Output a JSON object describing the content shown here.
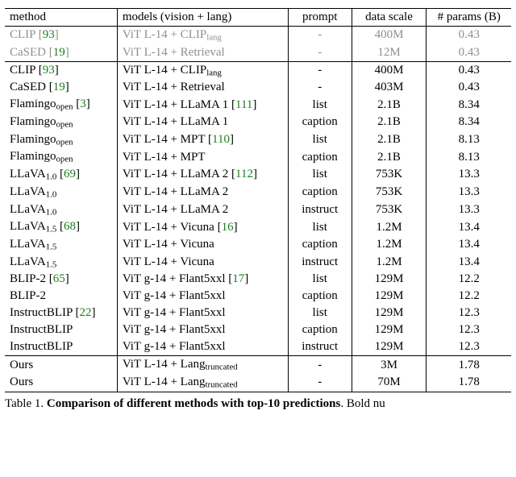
{
  "headers": {
    "method": "method",
    "models": "models (vision + lang)",
    "prompt": "prompt",
    "data_scale": "data scale",
    "params": "# params (B)"
  },
  "rows": [
    {
      "grey": true,
      "method": "CLIP",
      "ref": "93",
      "model_pre": "ViT L-14 + CLIP",
      "model_sub": "lang",
      "model_refs": [],
      "prompt": "-",
      "scale": "400M",
      "params": "0.43",
      "sect_start": true
    },
    {
      "grey": true,
      "method": "CaSED",
      "ref": "19",
      "model_pre": "ViT L-14 + Retrieval",
      "model_sub": "",
      "model_refs": [],
      "prompt": "-",
      "scale": "12M",
      "params": "0.43"
    },
    {
      "method": "CLIP",
      "ref": "93",
      "model_pre": "ViT L-14 + CLIP",
      "model_sub": "lang",
      "model_refs": [],
      "prompt": "-",
      "scale": "400M",
      "params": "0.43",
      "sect_start": true
    },
    {
      "method": "CaSED",
      "ref": "19",
      "model_pre": "ViT L-14 + Retrieval",
      "model_sub": "",
      "model_refs": [],
      "prompt": "-",
      "scale": "403M",
      "params": "0.43"
    },
    {
      "method": "Flamingo",
      "method_sub": "open",
      "ref": "3",
      "model_pre": "ViT L-14 + LLaMA 1",
      "model_sub": "",
      "model_refs": [
        "111"
      ],
      "prompt": "list",
      "scale": "2.1B",
      "params": "8.34"
    },
    {
      "method": "Flamingo",
      "method_sub": "open",
      "ref": "",
      "model_pre": "ViT L-14 + LLaMA 1",
      "model_sub": "",
      "model_refs": [],
      "prompt": "caption",
      "scale": "2.1B",
      "params": "8.34"
    },
    {
      "method": "Flamingo",
      "method_sub": "open",
      "ref": "",
      "model_pre": "ViT L-14 + MPT",
      "model_sub": "",
      "model_refs": [
        "110"
      ],
      "prompt": "list",
      "scale": "2.1B",
      "params": "8.13"
    },
    {
      "method": "Flamingo",
      "method_sub": "open",
      "ref": "",
      "model_pre": "ViT L-14 + MPT",
      "model_sub": "",
      "model_refs": [],
      "prompt": "caption",
      "scale": "2.1B",
      "params": "8.13"
    },
    {
      "method": "LLaVA",
      "method_sub": "1.0",
      "ref": "69",
      "model_pre": "ViT L-14 + LLaMA 2",
      "model_sub": "",
      "model_refs": [
        "112"
      ],
      "prompt": "list",
      "scale": "753K",
      "params": "13.3"
    },
    {
      "method": "LLaVA",
      "method_sub": "1.0",
      "ref": "",
      "model_pre": "ViT L-14 + LLaMA 2",
      "model_sub": "",
      "model_refs": [],
      "prompt": "caption",
      "scale": "753K",
      "params": "13.3"
    },
    {
      "method": "LLaVA",
      "method_sub": "1.0",
      "ref": "",
      "model_pre": "ViT L-14 + LLaMA 2",
      "model_sub": "",
      "model_refs": [],
      "prompt": "instruct",
      "scale": "753K",
      "params": "13.3"
    },
    {
      "method": "LLaVA",
      "method_sub": "1.5",
      "ref": "68",
      "model_pre": "ViT L-14 + Vicuna",
      "model_sub": "",
      "model_refs": [
        "16"
      ],
      "prompt": "list",
      "scale": "1.2M",
      "params": "13.4"
    },
    {
      "method": "LLaVA",
      "method_sub": "1.5",
      "ref": "",
      "model_pre": "ViT L-14 + Vicuna",
      "model_sub": "",
      "model_refs": [],
      "prompt": "caption",
      "scale": "1.2M",
      "params": "13.4"
    },
    {
      "method": "LLaVA",
      "method_sub": "1.5",
      "ref": "",
      "model_pre": "ViT L-14 + Vicuna",
      "model_sub": "",
      "model_refs": [],
      "prompt": "instruct",
      "scale": "1.2M",
      "params": "13.4"
    },
    {
      "method": "BLIP-2",
      "ref": "65",
      "model_pre": "ViT g-14 + Flant5xxl",
      "model_sub": "",
      "model_refs": [
        "17"
      ],
      "prompt": "list",
      "scale": "129M",
      "params": "12.2"
    },
    {
      "method": "BLIP-2",
      "ref": "",
      "model_pre": "ViT g-14 + Flant5xxl",
      "model_sub": "",
      "model_refs": [],
      "prompt": "caption",
      "scale": "129M",
      "params": "12.2"
    },
    {
      "method": "InstructBLIP",
      "ref": "22",
      "model_pre": "ViT g-14 + Flant5xxl",
      "model_sub": "",
      "model_refs": [],
      "prompt": "list",
      "scale": "129M",
      "params": "12.3"
    },
    {
      "method": "InstructBLIP",
      "ref": "",
      "model_pre": "ViT g-14 + Flant5xxl",
      "model_sub": "",
      "model_refs": [],
      "prompt": "caption",
      "scale": "129M",
      "params": "12.3"
    },
    {
      "method": "InstructBLIP",
      "ref": "",
      "model_pre": "ViT g-14 + Flant5xxl",
      "model_sub": "",
      "model_refs": [],
      "prompt": "instruct",
      "scale": "129M",
      "params": "12.3"
    },
    {
      "method": "Ours",
      "ref": "",
      "model_pre": "ViT L-14 + Lang",
      "model_sub": "truncated",
      "model_refs": [],
      "prompt": "-",
      "scale": "3M",
      "params": "1.78",
      "sect_start": true
    },
    {
      "method": "Ours",
      "ref": "",
      "model_pre": "ViT L-14 + Lang",
      "model_sub": "truncated",
      "model_refs": [],
      "prompt": "-",
      "scale": "70M",
      "params": "1.78"
    }
  ],
  "caption": {
    "label": "Table 1.",
    "bold": "Comparison of different methods with top-",
    "ten": "10",
    "bold2": " predictions",
    "tail": ". Bold nu"
  }
}
